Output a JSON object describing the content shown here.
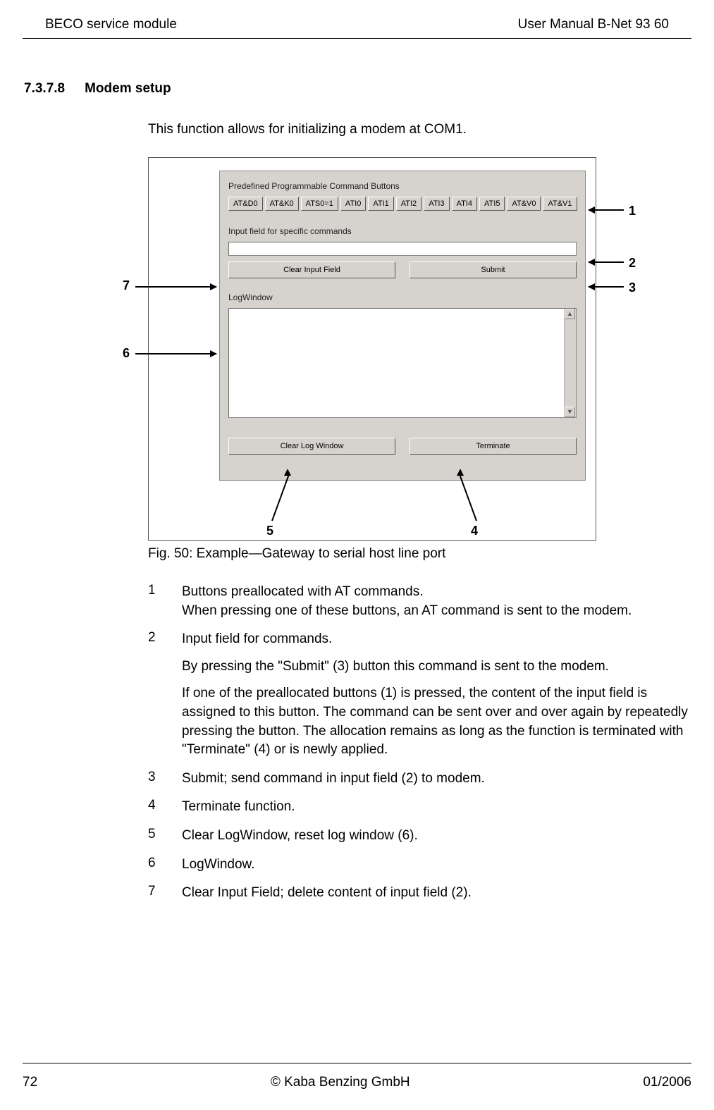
{
  "header": {
    "left": "BECO service module",
    "right": "User Manual B-Net 93 60"
  },
  "section": {
    "number": "7.3.7.8",
    "title": "Modem setup"
  },
  "intro": "This function allows for initializing a modem at COM1.",
  "figure": {
    "label_predef": "Predefined Programmable Command Buttons",
    "buttons": [
      "AT&D0",
      "AT&K0",
      "ATS0=1",
      "ATI0",
      "ATI1",
      "ATI2",
      "ATI3",
      "ATI4",
      "ATI5",
      "AT&V0",
      "AT&V1"
    ],
    "label_input": "Input field for specific commands",
    "btn_clear_input": "Clear Input Field",
    "btn_submit": "Submit",
    "label_log": "LogWindow",
    "btn_clear_log": "Clear Log Window",
    "btn_terminate": "Terminate",
    "callouts": {
      "1": "1",
      "2": "2",
      "3": "3",
      "4": "4",
      "5": "5",
      "6": "6",
      "7": "7"
    }
  },
  "caption": "Fig. 50: Example—Gateway to serial host line port",
  "items": {
    "i1": {
      "n": "1",
      "t": "Buttons preallocated with AT commands.\nWhen pressing one of these buttons, an AT command is sent to the modem."
    },
    "i2": {
      "n": "2",
      "t": "Input field for commands.",
      "s1": "By pressing the \"Submit\" (3) button this command is sent to the modem.",
      "s2": "If one of the preallocated buttons (1) is pressed, the content of the input field is assigned to this button. The command can be sent over and over again by repeatedly pressing the button. The allocation remains as long as the function is terminated with \"Terminate\" (4) or is newly applied."
    },
    "i3": {
      "n": "3",
      "t": "Submit; send command in input field (2) to modem."
    },
    "i4": {
      "n": "4",
      "t": "Terminate function."
    },
    "i5": {
      "n": "5",
      "t": "Clear LogWindow, reset log window (6)."
    },
    "i6": {
      "n": "6",
      "t": "LogWindow."
    },
    "i7": {
      "n": "7",
      "t": "Clear Input Field; delete content of input field (2)."
    }
  },
  "footer": {
    "page": "72",
    "center": "© Kaba Benzing GmbH",
    "date": "01/2006"
  }
}
